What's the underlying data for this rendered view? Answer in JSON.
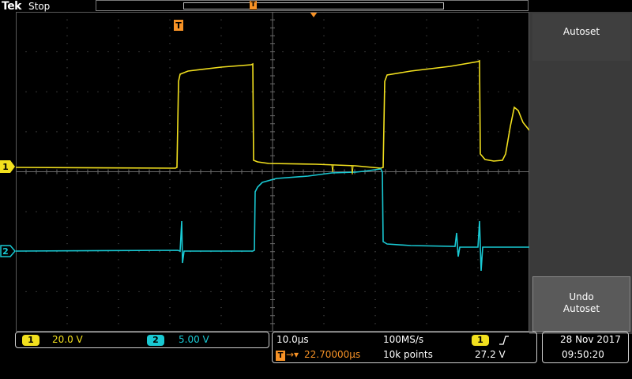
{
  "header": {
    "brand": "Tek",
    "acquisition_state": "Stop",
    "trigger_marker": "T"
  },
  "channels": [
    {
      "id": "1",
      "color": "#f2e01e",
      "scale": "20.0 V"
    },
    {
      "id": "2",
      "color": "#19c9d3",
      "scale": "5.00 V"
    }
  ],
  "horizontal": {
    "timebase": "10.0µs",
    "trigger_delay": "22.70000µs",
    "sample_rate": "100MS/s",
    "record_length": "10k points"
  },
  "trigger": {
    "source": "1",
    "slope_icon": "rising-edge-icon",
    "level": "27.2 V"
  },
  "datetime": {
    "date": "28 Nov 2017",
    "time": "09:50:20"
  },
  "side_menu": {
    "title": "Autoset",
    "undo_label_line1": "Undo",
    "undo_label_line2": "Autoset"
  },
  "colors": {
    "ch1": "#f2e01e",
    "ch2": "#19c9d3",
    "trigger": "#f79226",
    "grid": "#4a4a4a"
  }
}
